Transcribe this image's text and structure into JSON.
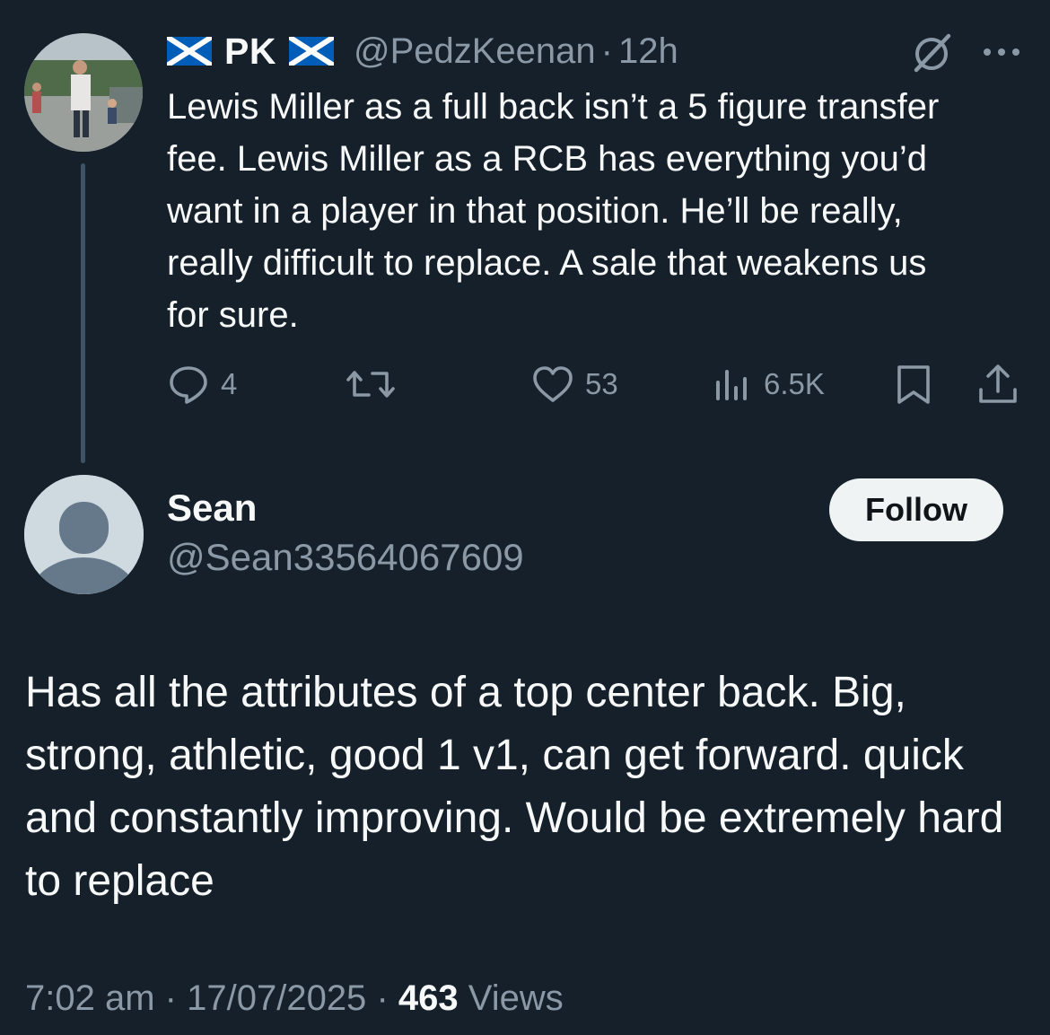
{
  "parent_tweet": {
    "display_name": "PK",
    "handle": "@PedzKeenan",
    "separator": "·",
    "time": "12h",
    "text": "Lewis Miller as a full back isn’t a 5 figure transfer fee. Lewis Miller as a RCB has everything you’d want in a player in that position. He’ll be really, really difficult to replace. A sale that weakens us for sure.",
    "actions": {
      "replies": "4",
      "reposts": "",
      "likes": "53",
      "views": "6.5K"
    }
  },
  "reply": {
    "display_name": "Sean",
    "handle": "@Sean33564067609",
    "follow_label": "Follow",
    "text": "Has all the attributes of a top center back. Big, strong, athletic, good 1 v1, can get forward. quick and constantly improving. Would be extremely hard to replace",
    "time": "7:02 am",
    "sep1": "·",
    "date": "17/07/2025",
    "sep2": "·",
    "views_count": "463",
    "views_label": "Views"
  },
  "icons": {
    "flag": "scotland-flag-icon",
    "grok": "grok-icon",
    "more": "more-icon",
    "reply": "reply-icon",
    "repost": "repost-icon",
    "like": "like-icon",
    "views": "views-icon",
    "bookmark": "bookmark-icon",
    "share": "share-icon"
  },
  "colors": {
    "background": "#15202b",
    "text_primary": "#f7f9f9",
    "text_secondary": "#8b98a5",
    "thread_line": "#3d5466",
    "follow_bg": "#eff3f4",
    "flag_blue": "#005eb8"
  }
}
